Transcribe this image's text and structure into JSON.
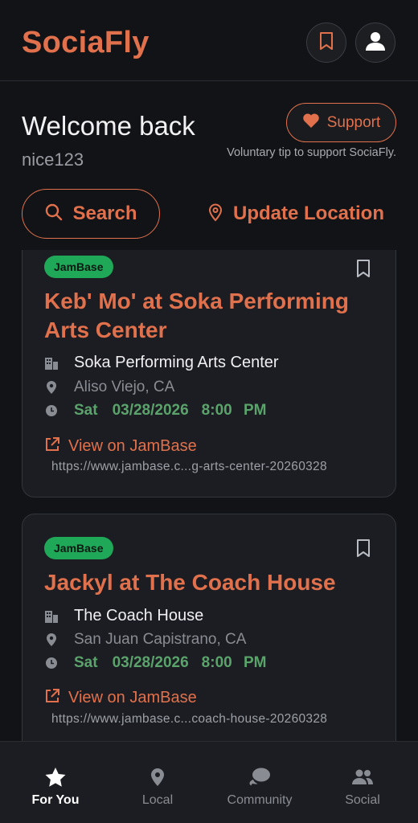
{
  "app": {
    "title": "SociaFly"
  },
  "header": {
    "bookmark_icon": "bookmark-icon",
    "profile_icon": "user-icon"
  },
  "welcome": {
    "greeting": "Welcome back",
    "username": "nice123"
  },
  "support": {
    "label": "Support",
    "note": "Voluntary tip to support SociaFly."
  },
  "actions": {
    "search_label": "Search",
    "location_label": "Update Location"
  },
  "events": [
    {
      "source": "JamBase",
      "title": "Keb' Mo' at Soka Performing Arts Center",
      "venue": "Soka Performing Arts Center",
      "city": "Aliso Viejo, CA",
      "day": "Sat",
      "date": "03/28/2026",
      "time": "8:00 PM",
      "link_label": "View on JamBase",
      "url": "https://www.jambase.c...g-arts-center-20260328"
    },
    {
      "source": "JamBase",
      "title": "Jackyl at The Coach House",
      "venue": "The Coach House",
      "city": "San Juan Capistrano, CA",
      "day": "Sat",
      "date": "03/28/2026",
      "time": "8:00 PM",
      "link_label": "View on JamBase",
      "url": "https://www.jambase.c...coach-house-20260328"
    }
  ],
  "nav": [
    {
      "label": "For You",
      "icon": "star-icon",
      "active": true
    },
    {
      "label": "Local",
      "icon": "location-pin-icon",
      "active": false
    },
    {
      "label": "Community",
      "icon": "chat-bubbles-icon",
      "active": false
    },
    {
      "label": "Social",
      "icon": "people-icon",
      "active": false
    }
  ],
  "colors": {
    "accent": "#e0714c",
    "badge": "#1fa858",
    "datetime": "#5aa36b",
    "background": "#121316",
    "card": "#1c1d22"
  }
}
